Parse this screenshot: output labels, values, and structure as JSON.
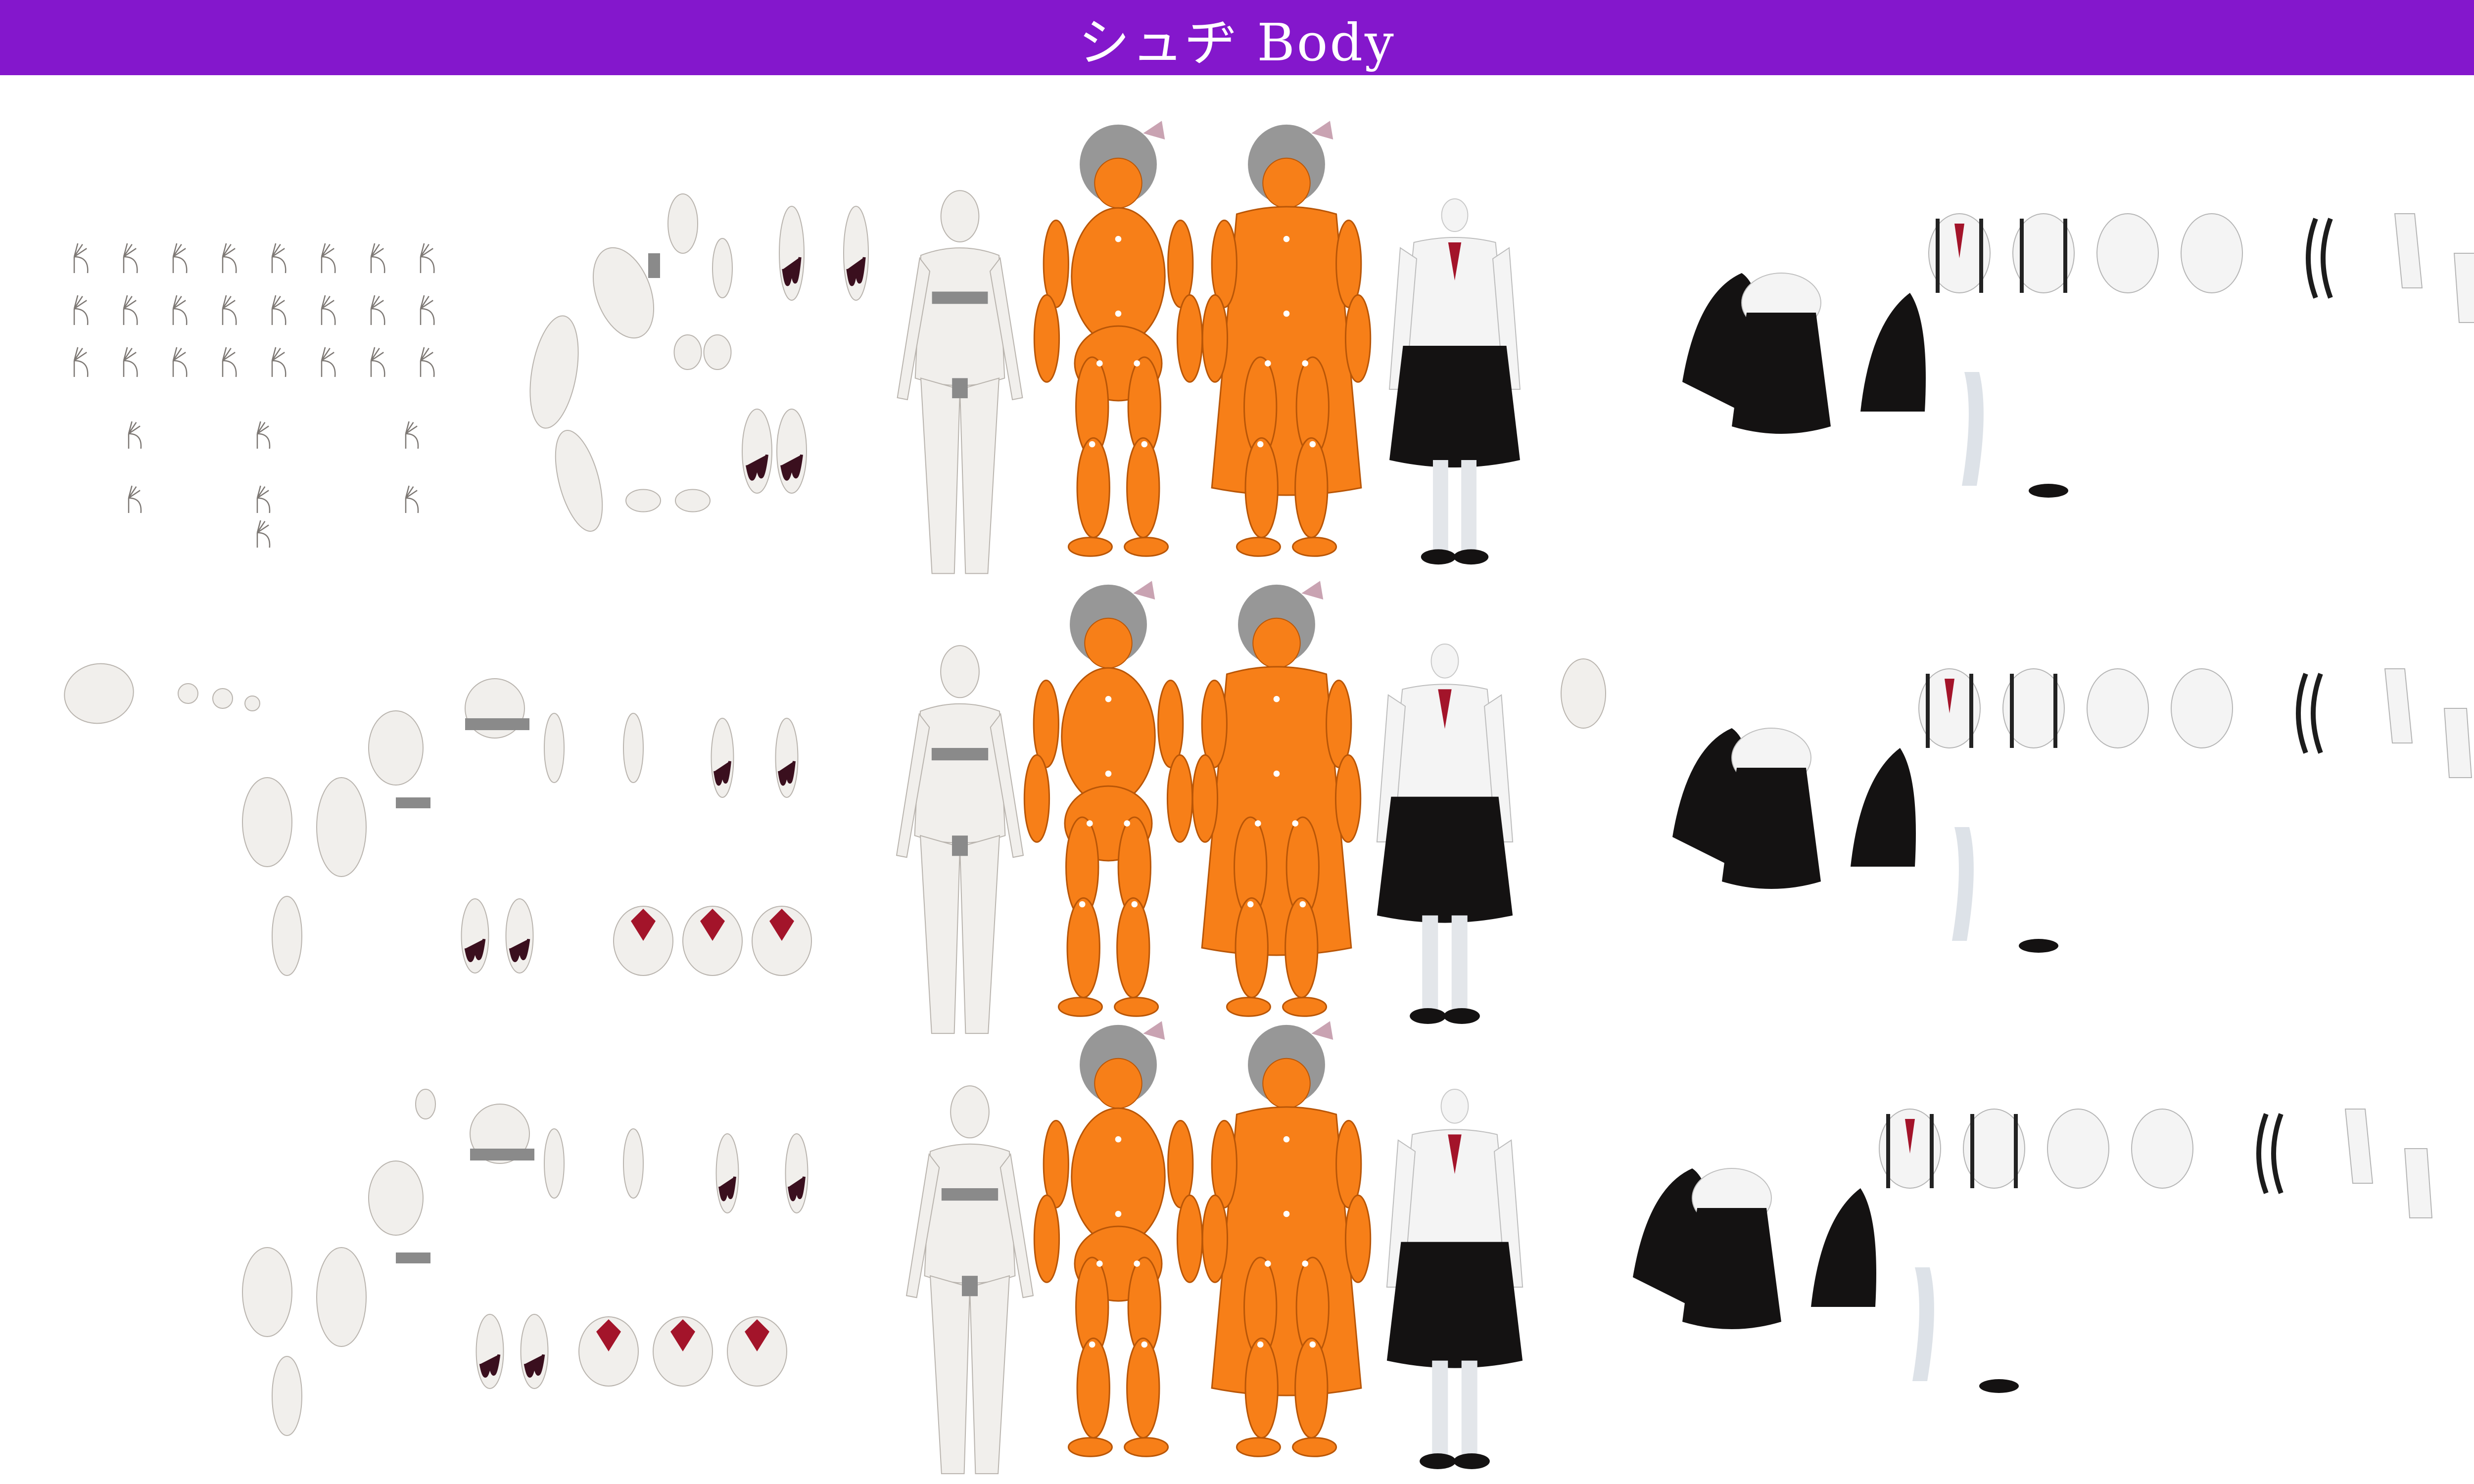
{
  "header": {
    "title": "シュヂ  Body"
  },
  "colors": {
    "banner": "#8417cc",
    "skin": "#f1efec",
    "skin_stroke": "#b9b4ae",
    "doll_orange": "#f77f18",
    "doll_stroke": "#b95607",
    "hair_gray": "#8c8c8c",
    "skirt_black": "#141212",
    "shirt_white": "#f4f4f4",
    "ribbon_red": "#a3142a",
    "censor_gray": "#8a8a8a",
    "wound_dark": "#3a0f1e"
  },
  "sheet": {
    "rows": [
      {
        "view": "side"
      },
      {
        "view": "front"
      },
      {
        "view": "back"
      }
    ]
  }
}
